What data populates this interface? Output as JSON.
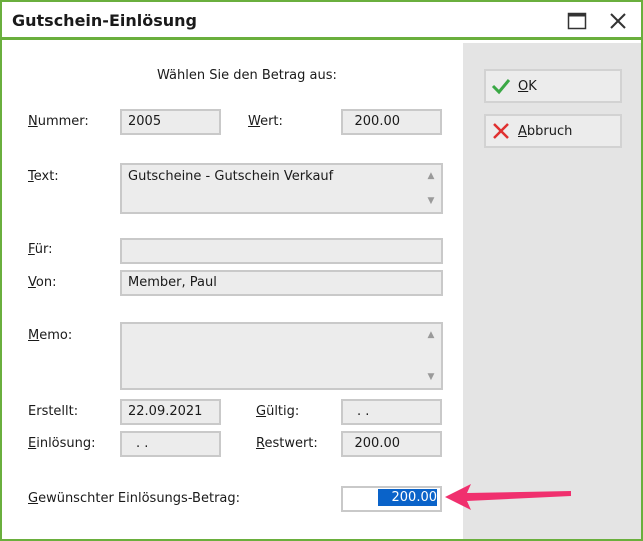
{
  "window": {
    "title": "Gutschein-Einlösung"
  },
  "form": {
    "heading": "Wählen Sie den Betrag aus:",
    "nummer": {
      "label_mnemonic": "N",
      "label_rest": "ummer:",
      "value": "2005"
    },
    "wert": {
      "label_mnemonic": "W",
      "label_rest": "ert:",
      "value": "200.00"
    },
    "text": {
      "label_mnemonic": "T",
      "label_rest": "ext:",
      "value": "Gutscheine - Gutschein Verkauf"
    },
    "fuer": {
      "label_mnemonic": "F",
      "label_rest": "ür:",
      "value": ""
    },
    "von": {
      "label_mnemonic": "V",
      "label_rest": "on:",
      "value": "Member, Paul"
    },
    "memo": {
      "label_mnemonic": "M",
      "label_rest": "emo:",
      "value": ""
    },
    "erstellt": {
      "label_mnemonic": "E",
      "label_rest": "rstellt:",
      "value": "22.09.2021"
    },
    "gueltig": {
      "label_mnemonic": "G",
      "label_rest": "ültig:",
      "value": ". ."
    },
    "einloesung": {
      "label_mnemonic": "E",
      "label_rest": "inlösung:",
      "value": ". ."
    },
    "restwert": {
      "label_mnemonic": "R",
      "label_rest": "estwert:",
      "value": "200.00"
    },
    "betrag": {
      "label_mnemonic": "G",
      "label_rest": "ewünschter Einlösungs-Betrag:",
      "value": "200.00"
    }
  },
  "buttons": {
    "ok": {
      "mnemonic": "O",
      "rest": "K"
    },
    "abbruch": {
      "mnemonic": "A",
      "rest": "bbruch"
    }
  },
  "colors": {
    "accent": "#6aaf3d",
    "selection": "#0a63c9",
    "arrow": "#f0306e",
    "ok_icon": "#3aa845",
    "cancel_icon": "#e03030"
  }
}
